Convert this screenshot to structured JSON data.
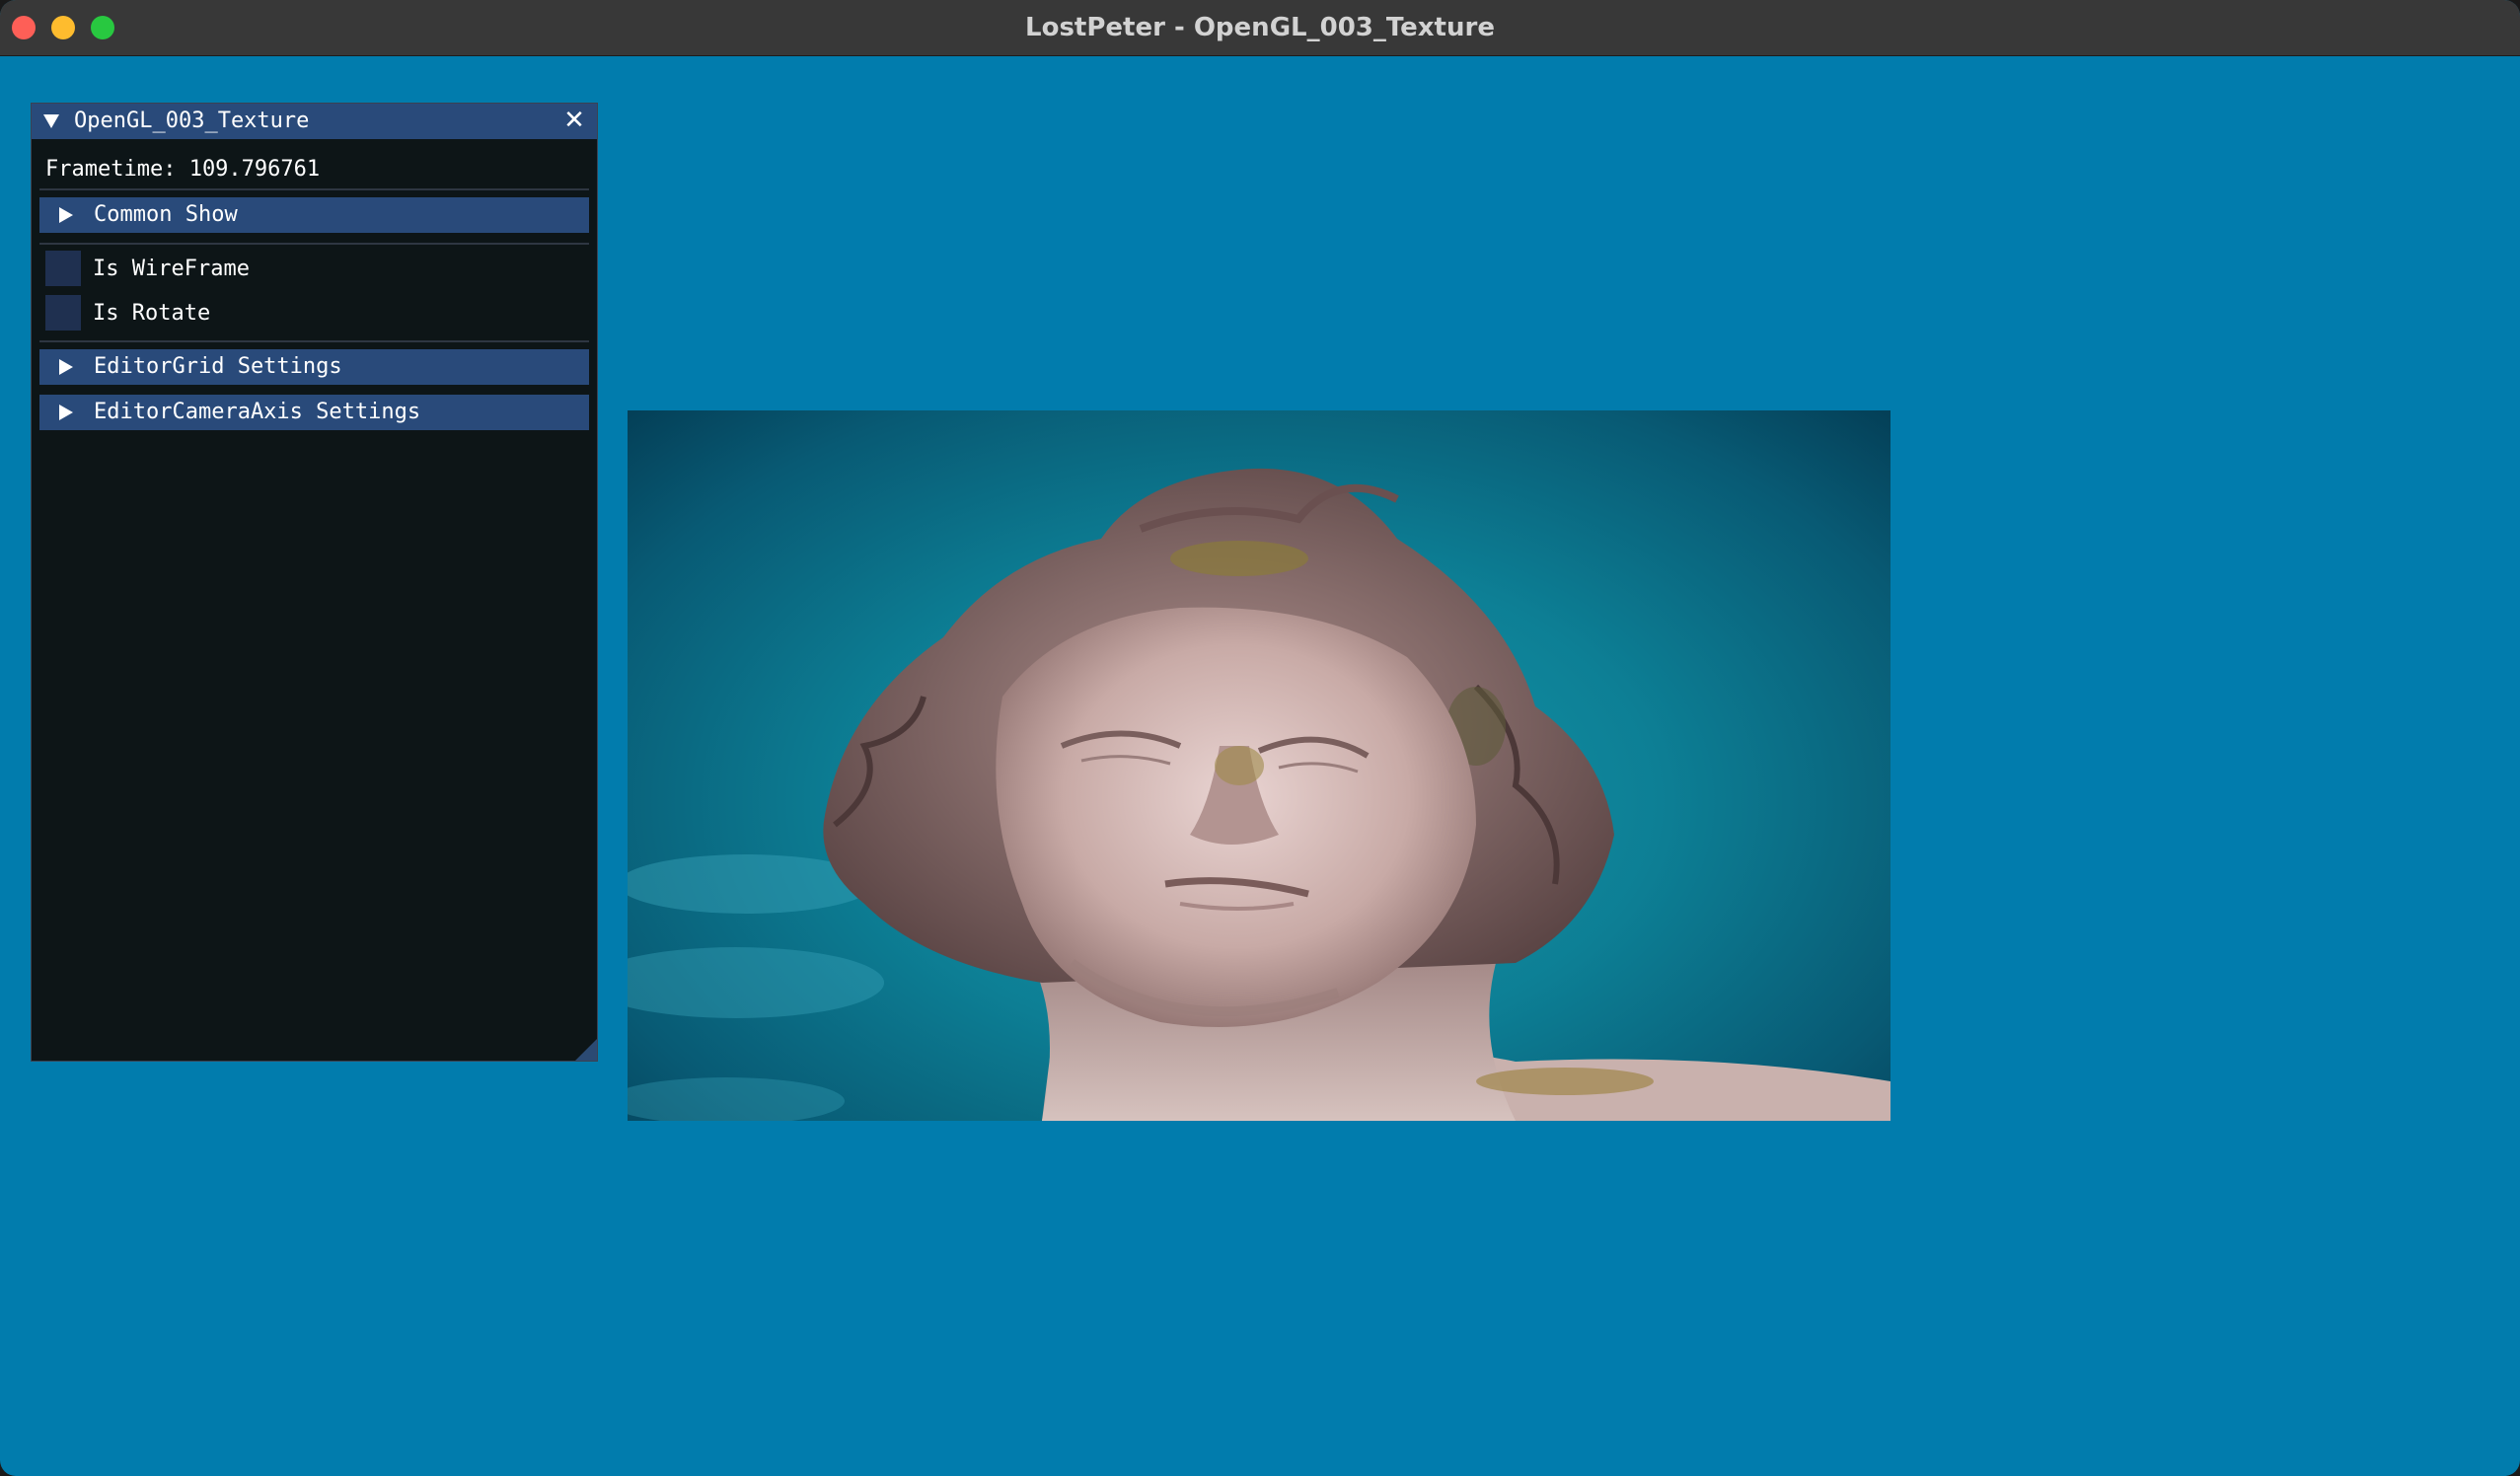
{
  "window": {
    "title": "LostPeter - OpenGL_003_Texture"
  },
  "panel": {
    "title": "OpenGL_003_Texture",
    "frametime_text": "Frametime: 109.796761",
    "sections": [
      {
        "label": "Common Show",
        "expanded": false
      },
      {
        "label": "EditorGrid Settings",
        "expanded": false
      },
      {
        "label": "EditorCameraAxis Settings",
        "expanded": false
      }
    ],
    "checkboxes": [
      {
        "label": "Is WireFrame",
        "checked": false
      },
      {
        "label": "Is Rotate",
        "checked": false
      }
    ]
  },
  "viewport": {
    "clear_color": "#017cad",
    "texture_subject": "stone statue head against teal sky"
  },
  "colors": {
    "titlebar": "#383838",
    "panel_bg": "#0d1517",
    "header_bg": "#294a7a",
    "checkbox_bg": "#1f3050"
  }
}
